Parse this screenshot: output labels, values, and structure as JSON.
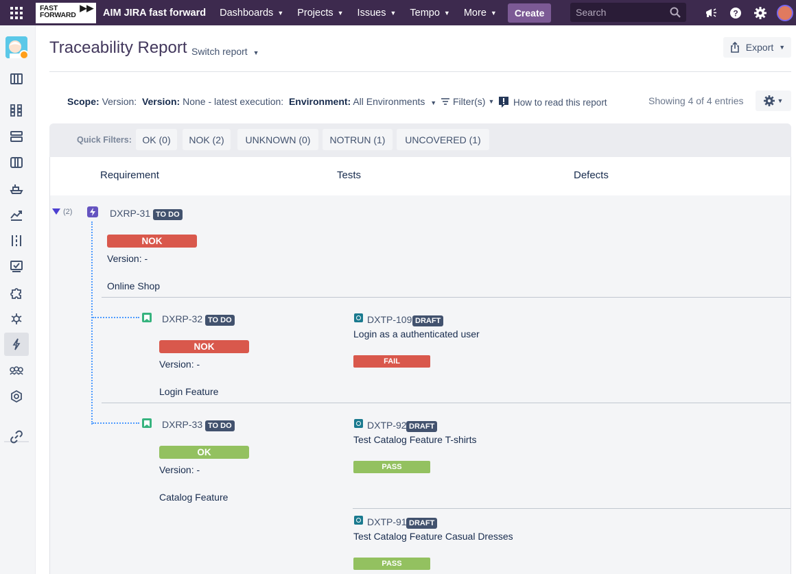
{
  "topbar": {
    "logo_text": "FAST FORWARD",
    "site_name": "AIM JIRA fast forward",
    "nav": [
      "Dashboards",
      "Projects",
      "Issues",
      "Tempo",
      "More"
    ],
    "create_label": "Create",
    "search_placeholder": "Search",
    "bg_color": "#3d2a4e"
  },
  "sidebar": {
    "icons": [
      "board-icon",
      "apps-icon",
      "backlog-icon",
      "columns-icon",
      "ship-icon",
      "reports-icon",
      "pipeline-icon",
      "test-board-icon",
      "add-ons-icon",
      "components-icon",
      "traceability-icon",
      "teams-icon",
      "settings-hex-icon",
      "link-icon"
    ],
    "active": "traceability-icon"
  },
  "header": {
    "title": "Traceability Report",
    "switch_report": "Switch report",
    "export_label": "Export"
  },
  "scope": {
    "scope_label": "Scope:",
    "scope_value": "Version:",
    "version_label": "Version:",
    "version_value": "None - latest execution:",
    "env_label": "Environment:",
    "env_value": "All Environments",
    "filters_label": "Filter(s)",
    "howto_label": "How to read this report",
    "showing": "Showing 4 of 4 entries"
  },
  "quick_filters": {
    "label": "Quick Filters:",
    "items": [
      "OK (0)",
      "NOK (2)",
      "UNKNOWN (0)",
      "NOTRUN (1)",
      "UNCOVERED (1)"
    ]
  },
  "table": {
    "headers": [
      "Requirement",
      "Tests",
      "Defects"
    ],
    "group_count": "(2)",
    "parent": {
      "key": "DXRP-31",
      "status": "TO DO",
      "result": "NOK",
      "version": "Version: -",
      "summary": "Online Shop"
    },
    "children": [
      {
        "key": "DXRP-32",
        "status": "TO DO",
        "result": "NOK",
        "version": "Version: -",
        "summary": "Login Feature",
        "tests": [
          {
            "key": "DXTP-109",
            "status": "DRAFT",
            "summary": "Login as a authenticated user",
            "result": "FAIL"
          }
        ]
      },
      {
        "key": "DXRP-33",
        "status": "TO DO",
        "result": "OK",
        "version": "Version: -",
        "summary": "Catalog Feature",
        "tests": [
          {
            "key": "DXTP-92",
            "status": "DRAFT",
            "summary": "Test Catalog Feature T-shirts",
            "result": "PASS"
          },
          {
            "key": "DXTP-91",
            "status": "DRAFT",
            "summary": "Test Catalog Feature Casual Dresses",
            "result": "PASS"
          }
        ]
      }
    ]
  }
}
